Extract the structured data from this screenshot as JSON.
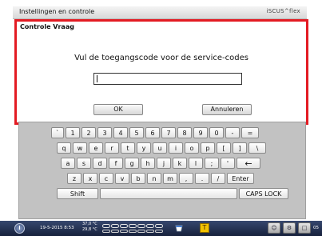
{
  "window": {
    "title": "Instellingen en controle",
    "brand": "iSCUS^flex"
  },
  "dialog": {
    "title": "Controle Vraag",
    "prompt": "Vul de toegangscode voor de service-codes",
    "input_value": "",
    "ok_label": "OK",
    "cancel_label": "Annuleren"
  },
  "keyboard": {
    "rows": [
      [
        "`",
        "1",
        "2",
        "3",
        "4",
        "5",
        "6",
        "7",
        "8",
        "9",
        "0",
        "-",
        "="
      ],
      [
        "q",
        "w",
        "e",
        "r",
        "t",
        "y",
        "u",
        "i",
        "o",
        "p",
        "[",
        "]",
        "\\"
      ],
      [
        "a",
        "s",
        "d",
        "f",
        "g",
        "h",
        "j",
        "k",
        "l",
        ";",
        "'",
        "←"
      ],
      [
        "z",
        "x",
        "c",
        "v",
        "b",
        "n",
        "m",
        ",",
        ".",
        "/",
        "Enter"
      ],
      [
        "Shift",
        "",
        "CAPS LOCK"
      ]
    ]
  },
  "taskbar": {
    "date_time": "19-5-2015 8:53",
    "temp_line1": "37,0 °C",
    "temp_line2": "29,8 °C",
    "right_number": "05"
  }
}
